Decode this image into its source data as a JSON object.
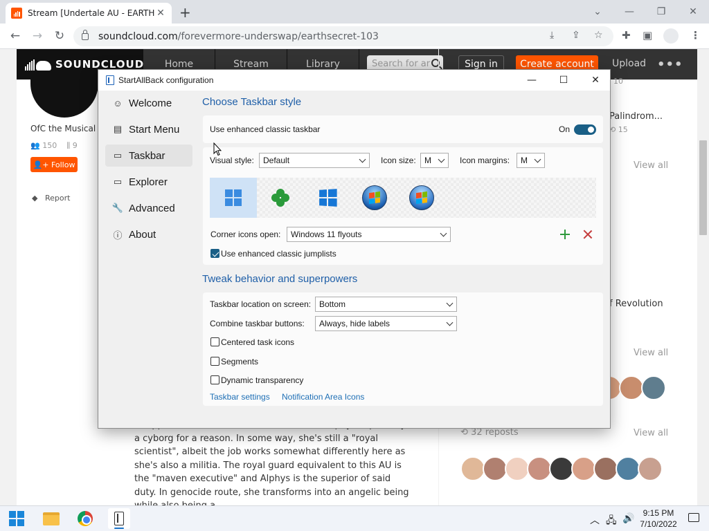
{
  "browser": {
    "tab_title": "Stream [Undertale AU - EARTHSE",
    "tab_close": "✕",
    "new_tab": "+",
    "url_host": "soundcloud.com",
    "url_path": "/forevermore-underswap/earthsecret-103",
    "window_controls": [
      "⌄",
      "—",
      "❐",
      "✕"
    ]
  },
  "soundcloud": {
    "logo": "SOUNDCLOUD",
    "nav": [
      "Home",
      "Stream",
      "Library"
    ],
    "search_placeholder": "Search for ar",
    "sign_in": "Sign in",
    "create_account": "Create account",
    "upload": "Upload",
    "more": "•••",
    "artist_name": "OfC the Musical",
    "followers": "150",
    "tracks": "9",
    "follow": "Follow",
    "report": "Report",
    "side_count": "10",
    "side_title": "Palindrom...",
    "side_reposts": "15",
    "side_revolution": "f Revolution",
    "view_all": "View all",
    "reposts": "32 reposts",
    "description": "swapped with each other no matter what. Alphys is partially a cyborg for a reason. In some way, she's still a \"royal scientist\", albeit the job works somewhat differently here as she's also a militia. The royal guard equivalent to this AU is the \"maven executive\" and Alphys is the superior of said duty. In genocide route, she transforms into an angelic being while also being a"
  },
  "dialog": {
    "title": "StartAllBack configuration",
    "nav": [
      {
        "label": "Welcome",
        "icon": "☺"
      },
      {
        "label": "Start Menu",
        "icon": "▤"
      },
      {
        "label": "Taskbar",
        "icon": "▭"
      },
      {
        "label": "Explorer",
        "icon": "▭"
      },
      {
        "label": "Advanced",
        "icon": "🔧"
      },
      {
        "label": "About",
        "icon": "ⓘ"
      }
    ],
    "section1_title": "Choose Taskbar style",
    "enhanced_taskbar_label": "Use enhanced classic taskbar",
    "enhanced_taskbar_state": "On",
    "visual_style_label": "Visual style:",
    "visual_style_value": "Default",
    "icon_size_label": "Icon size:",
    "icon_size_value": "M",
    "icon_margins_label": "Icon margins:",
    "icon_margins_value": "M",
    "styles": [
      "windows-11",
      "clover",
      "windows-10",
      "windows-7",
      "windows-vista"
    ],
    "corner_icons_label": "Corner icons open:",
    "corner_icons_value": "Windows 11 flyouts",
    "jumplists_label": "Use enhanced classic jumplists",
    "jumplists_checked": true,
    "section2_title": "Tweak behavior and superpowers",
    "location_label": "Taskbar location on screen:",
    "location_value": "Bottom",
    "combine_label": "Combine taskbar buttons:",
    "combine_value": "Always, hide labels",
    "centered_label": "Centered task icons",
    "segments_label": "Segments",
    "dynamic_label": "Dynamic transparency",
    "link_taskbar_settings": "Taskbar settings",
    "link_notification_icons": "Notification Area Icons"
  },
  "taskbar": {
    "time": "9:15 PM",
    "date": "7/10/2022",
    "tray_chevron": "︿"
  }
}
